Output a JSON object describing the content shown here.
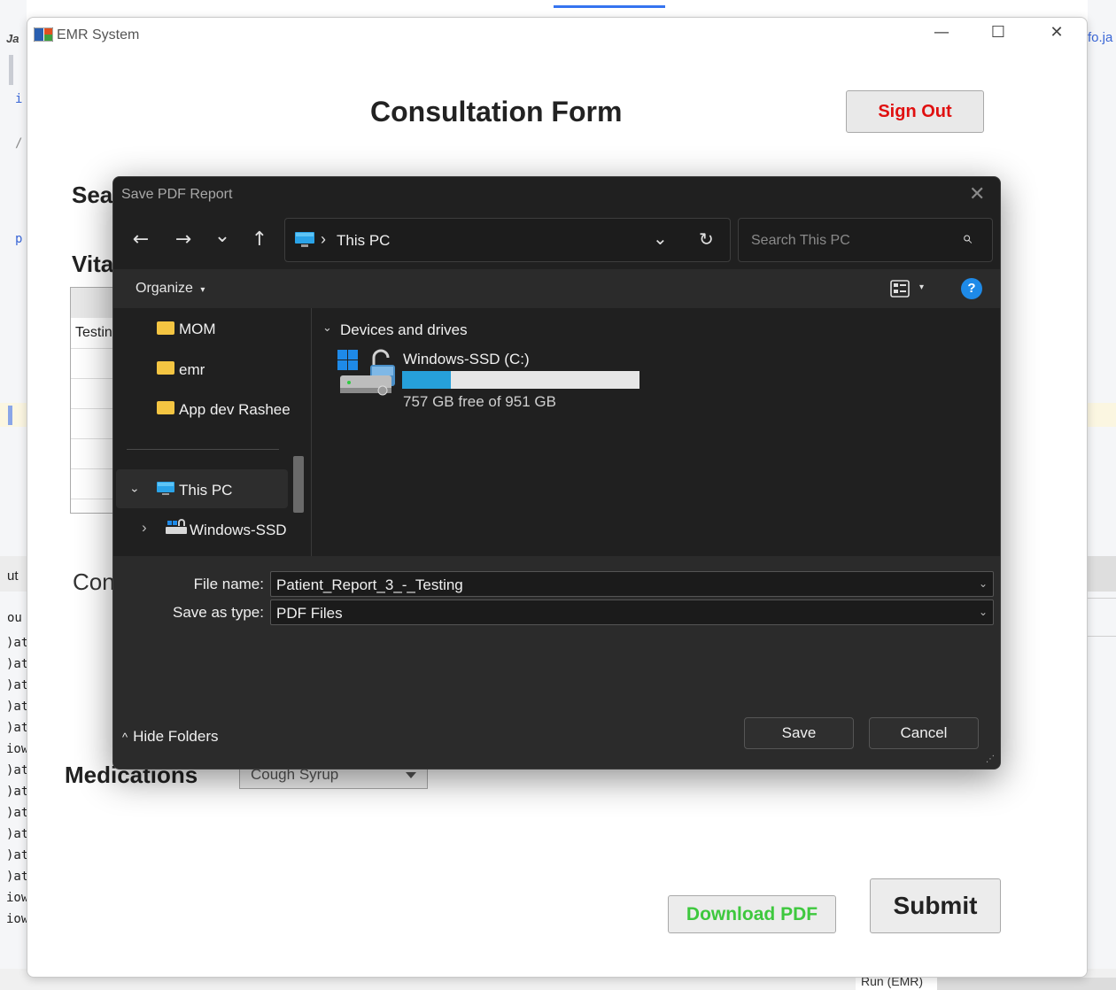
{
  "background_ide": {
    "code_fragments": [
      "i",
      "/",
      "p"
    ],
    "console_lines": [
      "ut",
      "ou",
      ")at",
      ")at",
      ")at",
      ")at",
      ")at",
      "iow",
      ")at",
      ")at",
      ")at",
      ")at",
      ")at",
      ")at",
      "iow",
      "iow"
    ],
    "right_fragment": "fo.ja",
    "logo_fragment": "Ja",
    "run_tab": "Run (EMR)"
  },
  "window": {
    "title": "EMR System",
    "controls": {
      "minimize": "—",
      "maximize": "☐",
      "close": "✕"
    }
  },
  "form": {
    "title": "Consultation Form",
    "sign_out": "Sign Out",
    "search_label": "Sea",
    "vitals_label": "Vita",
    "vitals_cell": "Testin",
    "consult_label": "Con",
    "medications_label": "Medications",
    "medications_value": "Cough Syrup",
    "download_pdf": "Download PDF",
    "submit": "Submit"
  },
  "dialog": {
    "title": "Save PDF Report",
    "close": "✕",
    "nav": {
      "back": "←",
      "forward": "→",
      "recent": "⌄",
      "up": "↑"
    },
    "address": {
      "separator": "›",
      "location": "This PC",
      "dropdown": "⌄",
      "refresh": "↻"
    },
    "search_placeholder": "Search This PC",
    "search_icon": "⌕",
    "organize": "Organize",
    "organize_caret": "▾",
    "view_caret": "▾",
    "help": "?",
    "nav_pane": {
      "items": [
        {
          "label": "MOM",
          "icon": "folder-icon"
        },
        {
          "label": "emr",
          "icon": "folder-icon"
        },
        {
          "label": "App dev Rashee",
          "icon": "folder-icon"
        }
      ],
      "this_pc": {
        "label": "This PC",
        "icon": "pc-icon",
        "chevron": "⌄"
      },
      "drive": {
        "label": "Windows-SSD",
        "icon": "drive-icon",
        "chevron": "›"
      }
    },
    "content": {
      "group_chevron": "⌄",
      "group_label": "Devices and drives",
      "drive_name": "Windows-SSD (C:)",
      "drive_space": "757 GB free of 951 GB",
      "used_fraction": 0.204
    },
    "file_name_label": "File name:",
    "file_name_value": "Patient_Report_3_-_Testing",
    "save_type_label": "Save as type:",
    "save_type_value": "PDF Files",
    "hide_folders": "Hide Folders",
    "hide_folders_caret": "^",
    "save": "Save",
    "cancel": "Cancel"
  },
  "colors": {
    "sign_out_text": "#e01010",
    "download_text": "#3ec83e",
    "accent_blue": "#1e8ae8",
    "drive_bar": "#26a0da",
    "dialog_bg": "#202020"
  }
}
